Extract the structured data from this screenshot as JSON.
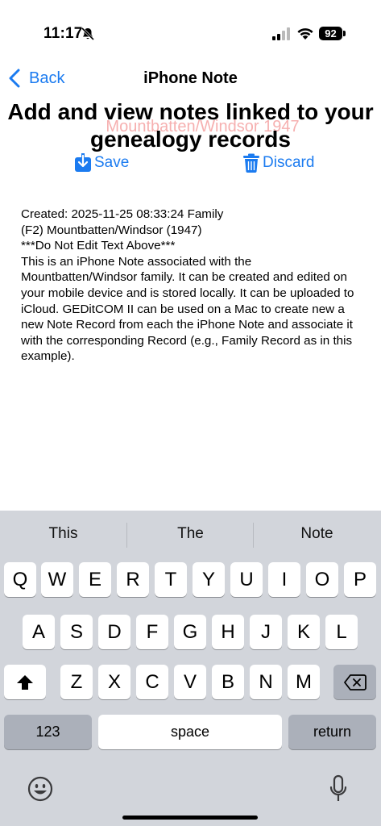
{
  "status_bar": {
    "time": "11:17",
    "battery_level": "92"
  },
  "nav": {
    "back_label": "Back",
    "title": "iPhone Note"
  },
  "header": {
    "heading": "Add and view notes linked to your genealogy records",
    "record_name": "Mountbatten/Windsor 1947"
  },
  "actions": {
    "save_label": "Save",
    "discard_label": "Discard"
  },
  "note": {
    "text": "Created: 2025-11-25 08:33:24 Family\n(F2) Mountbatten/Windsor (1947)\n***Do Not Edit Text Above***\nThis is an iPhone Note associated with the Mountbatten/Windsor family.  It can be created and edited on your mobile device and is stored locally.  It can be uploaded to iCloud.  GEDitCOM II can be used on a Mac to create new a new Note Record from each the iPhone Note and associate it with the corresponding Record (e.g., Family Record as in this example)."
  },
  "keyboard": {
    "suggestions": [
      "This",
      "The",
      "Note"
    ],
    "row1": [
      "Q",
      "W",
      "E",
      "R",
      "T",
      "Y",
      "U",
      "I",
      "O",
      "P"
    ],
    "row2": [
      "A",
      "S",
      "D",
      "F",
      "G",
      "H",
      "J",
      "K",
      "L"
    ],
    "row3": [
      "Z",
      "X",
      "C",
      "V",
      "B",
      "N",
      "M"
    ],
    "numbers_label": "123",
    "space_label": "space",
    "return_label": "return"
  },
  "colors": {
    "accent": "#1b7bf0",
    "record_name": "#f6b0b0",
    "keyboard_bg": "#d2d5db"
  },
  "icons": [
    "mute-bell-icon",
    "signal-icon",
    "wifi-icon",
    "chevron-left-icon",
    "save-download-icon",
    "trash-icon",
    "shift-icon",
    "delete-icon",
    "emoji-icon",
    "microphone-icon"
  ]
}
